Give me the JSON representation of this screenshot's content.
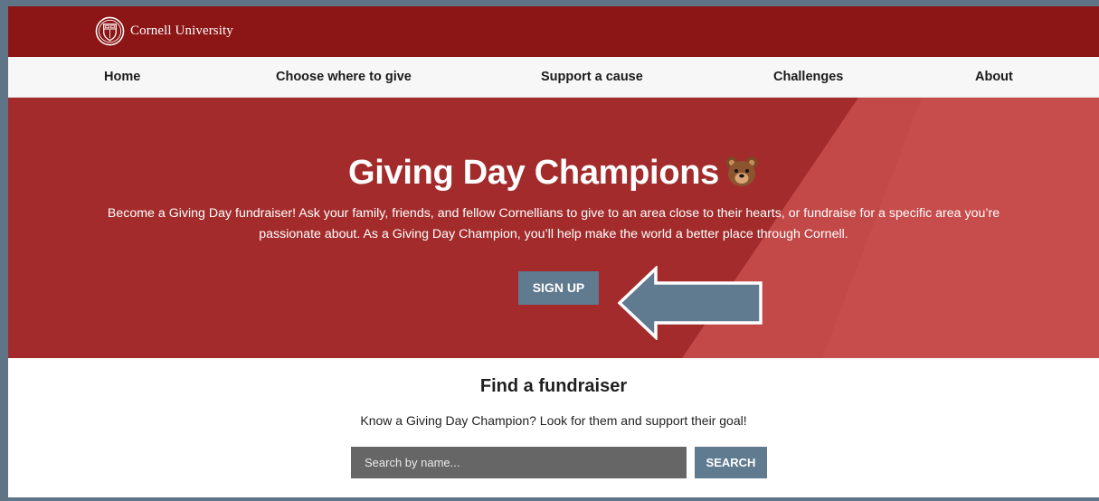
{
  "header": {
    "logo_text": "Cornell University",
    "logo_icon": "cornell-seal-icon"
  },
  "nav": {
    "items": [
      {
        "label": "Home"
      },
      {
        "label": "Choose where to give"
      },
      {
        "label": "Support a cause"
      },
      {
        "label": "Challenges"
      },
      {
        "label": "About"
      }
    ]
  },
  "hero": {
    "title": "Giving Day Champions",
    "title_emoji_icon": "bear-face-icon",
    "description": "Become a Giving Day fundraiser! Ask your family, friends, and fellow Cornellians to give to an area close to their hearts, or fundraise for a specific area you’re passionate about. As a Giving Day Champion, you’ll help make the world a better place through Cornell.",
    "signup_label": "SIGN UP",
    "annotation_icon": "left-arrow-callout-icon"
  },
  "find": {
    "title": "Find a fundraiser",
    "description": "Know a Giving Day Champion? Look for them and support their goal!",
    "search_placeholder": "Search by name...",
    "search_button": "SEARCH"
  },
  "colors": {
    "brand_red": "#8c1515",
    "hero_red": "#a32b2b",
    "button_slate": "#607a8f",
    "search_field": "#666666"
  }
}
